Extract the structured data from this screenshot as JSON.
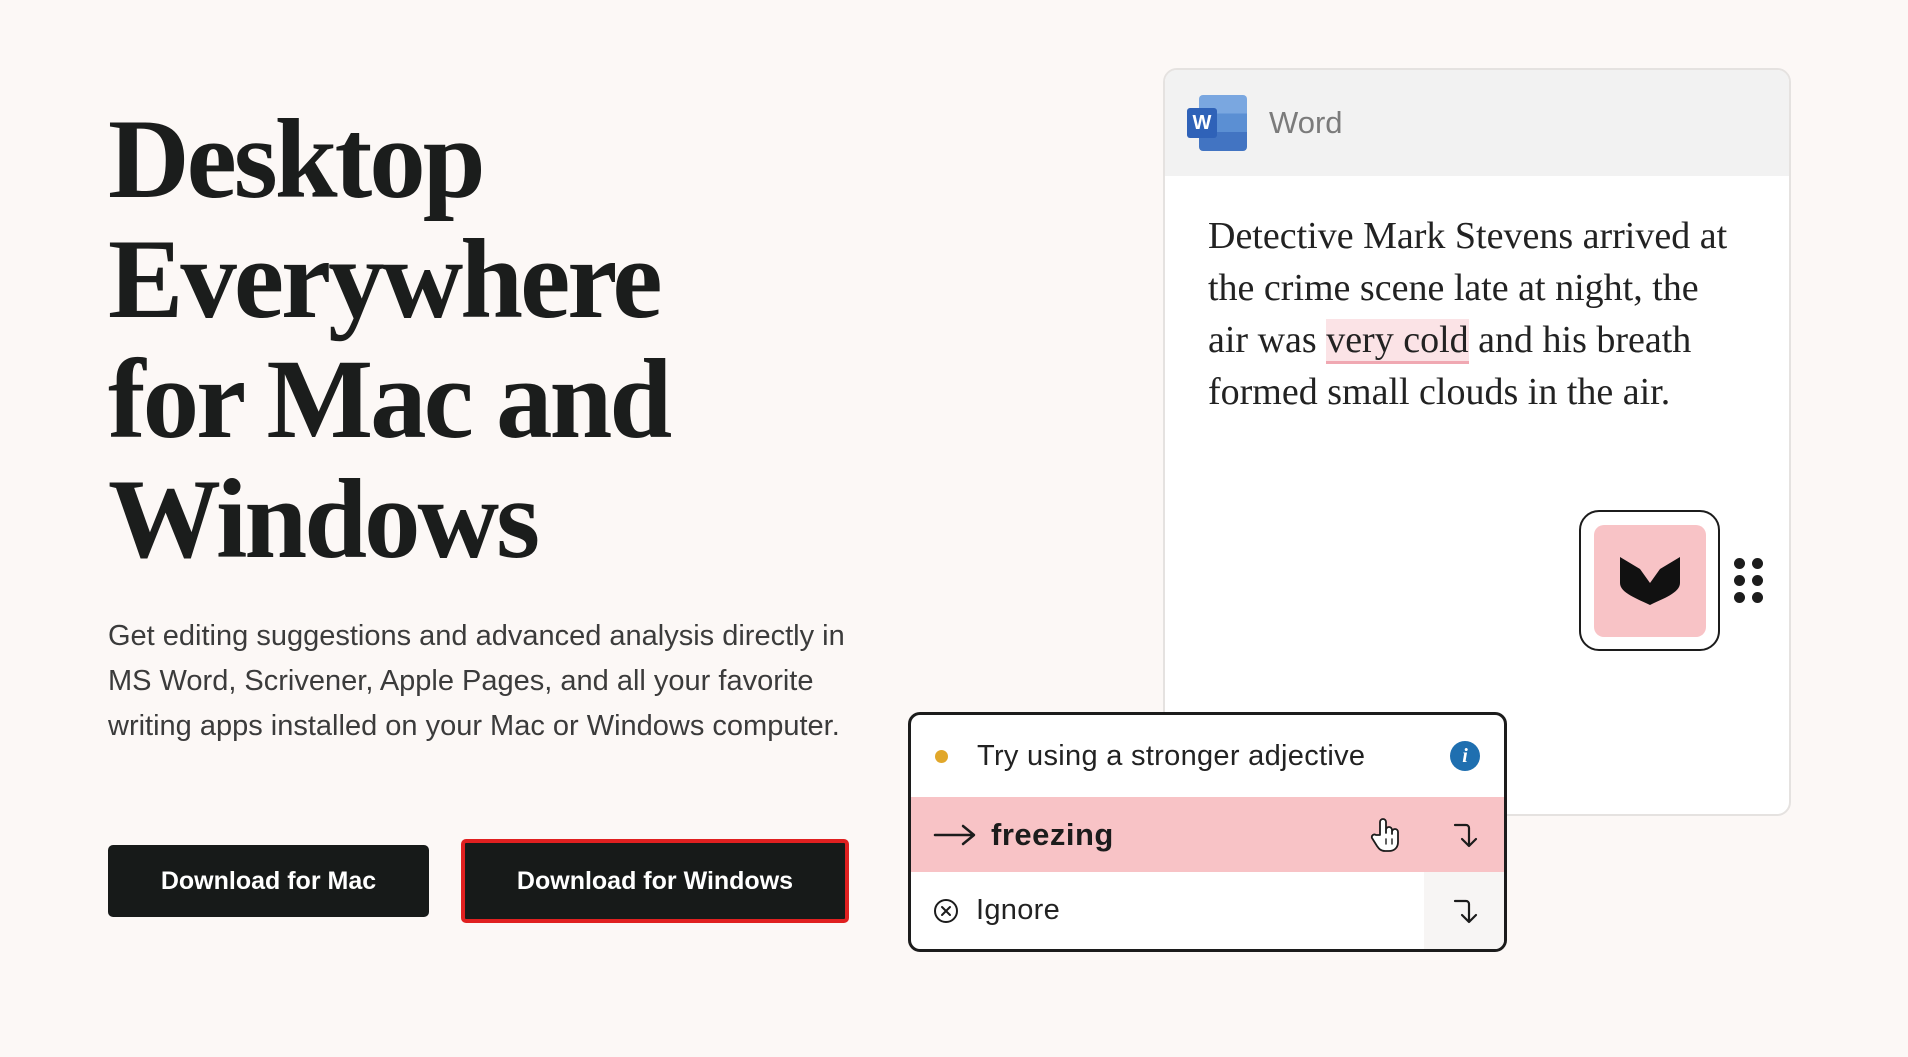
{
  "hero": {
    "title_lines": [
      "Desktop",
      "Everywhere",
      "for Mac and",
      "Windows"
    ],
    "description": "Get editing suggestions and advanced analysis directly in MS Word, Scrivener, Apple Pages, and all your favorite writing apps installed on your Mac or Windows computer."
  },
  "buttons": {
    "mac": "Download for Mac",
    "windows": "Download for Windows"
  },
  "word_card": {
    "app_name": "Word",
    "app_icon_letter": "W",
    "text_before": "Detective Mark Stevens arrived at the crime scene late at night, the air was ",
    "highlighted": "very cold",
    "text_after": " and his breath formed small clouds in the air."
  },
  "popup": {
    "suggestion": "Try using a stronger adjective",
    "replacement": "freezing",
    "ignore_label": "Ignore"
  },
  "colors": {
    "background": "#fcf8f6",
    "button": "#171a19",
    "selected_outline": "#e02020",
    "highlight_fill": "#fbe3e6",
    "accent_pink": "#f8c3c6",
    "suggestion_dot": "#e1a72a",
    "info_blue": "#1f6fb0"
  },
  "icons": [
    "word-app-icon",
    "prowritingaid-logo-icon",
    "drag-handle-icon",
    "info-icon",
    "arrow-right-icon",
    "hand-pointer-icon",
    "apply-arrow-icon",
    "close-circle-icon"
  ]
}
